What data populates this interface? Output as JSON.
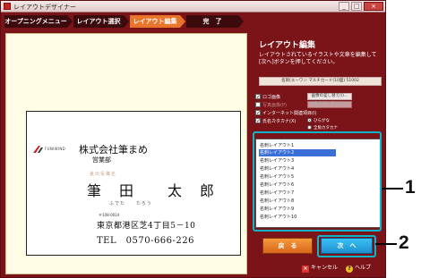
{
  "window": {
    "title": "レイアウトデザイナー"
  },
  "titlebar_buttons": [
    "_",
    "□",
    "×"
  ],
  "steps": [
    {
      "label": "オープニングメニュー",
      "state": "done"
    },
    {
      "label": "レイアウト選択",
      "state": "done"
    },
    {
      "label": "レイアウト編集",
      "state": "active"
    },
    {
      "label": "完　了",
      "state": "pending"
    }
  ],
  "card": {
    "logo_text": "FUNIWIND",
    "company": "株式会社筆まめ",
    "department": "営業部",
    "title_ruby": "差出役職名",
    "name": "筆　田　　太　郎",
    "name_ruby": "ふでた　　たろう",
    "zip": "〒108-0014",
    "address": "東京都港区芝4丁目5－10",
    "tel": "TEL　0570-666-226"
  },
  "panel": {
    "title": "レイアウト編集",
    "description": "レイアウトされているイラストや文章を編集して[次へ]ボタンを押してください。",
    "card_name": "名刺(エーワン マルチカード(10面) 51002",
    "options": [
      {
        "label": "ロゴ画像",
        "checked": true,
        "button": "画像の差し替え(I)...",
        "dim": false
      },
      {
        "label": "写真画像(P)",
        "checked": false,
        "button": "画像の差し替え(O)...",
        "dim": true
      },
      {
        "label": "インターネット関連項目(I)",
        "checked": true,
        "button": "",
        "dim": false
      },
      {
        "label": "氏名カタカナ(X)",
        "checked": true,
        "button": "",
        "dim": false
      }
    ],
    "ruby_radio": {
      "option_a": "ひらがな",
      "option_b": "全角カタカナ",
      "selected": "option_a"
    },
    "layouts": [
      "名刺レイアウト1",
      "名刺レイアウト2",
      "名刺レイアウト3",
      "名刺レイアウト4",
      "名刺レイアウト5",
      "名刺レイアウト6",
      "名刺レイアウト7",
      "名刺レイアウト8",
      "名刺レイアウト9",
      "名刺レイアウト10"
    ],
    "selected_layout_index": 1,
    "back_label": "戻　る",
    "next_label": "次　へ",
    "cancel_label": "キャンセル",
    "help_label": "ヘルプ"
  },
  "callouts": [
    "1",
    "2"
  ],
  "colors": {
    "accent": "#e8752a",
    "frame": "#7a1418",
    "next": "#1e8fd1",
    "highlight": "#0fb6c8"
  }
}
